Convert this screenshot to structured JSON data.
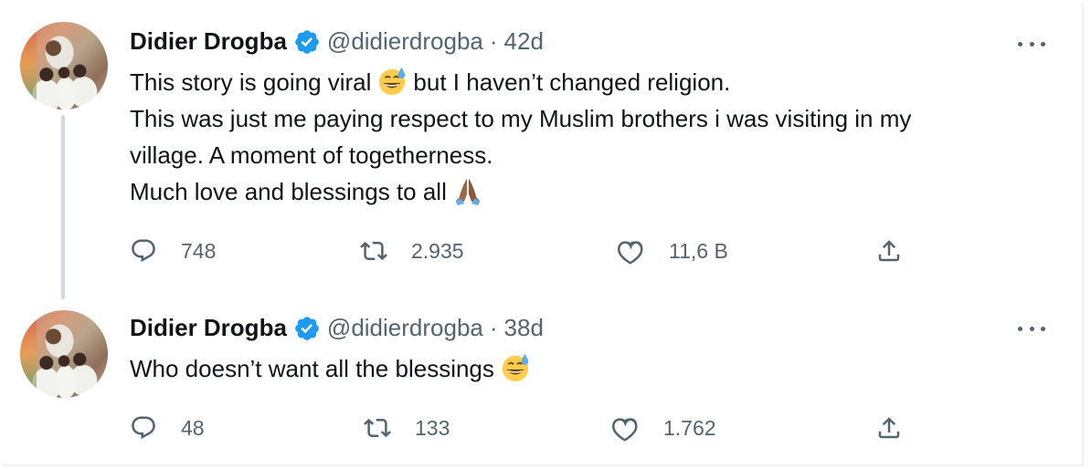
{
  "tweets": [
    {
      "author_name": "Didier Drogba",
      "handle": "@didierdrogba",
      "separator": "·",
      "time": "42d",
      "lines": [
        {
          "before": "This story is going viral",
          "emoji": "sweat-smile",
          "after": "but I haven’t changed religion."
        },
        {
          "before": "This was just me paying respect to my Muslim brothers i was visiting in my",
          "emoji": null,
          "after": ""
        },
        {
          "before": "village. A moment of togetherness.",
          "emoji": null,
          "after": ""
        },
        {
          "before": "Much love and blessings to all",
          "emoji": "folded-hands",
          "after": ""
        }
      ],
      "replies": "748",
      "retweets": "2.935",
      "likes": "11,6 B"
    },
    {
      "author_name": "Didier Drogba",
      "handle": "@didierdrogba",
      "separator": "·",
      "time": "38d",
      "lines": [
        {
          "before": "Who doesn’t want all the blessings",
          "emoji": "sweat-smile",
          "after": ""
        }
      ],
      "replies": "48",
      "retweets": "133",
      "likes": "1.762"
    }
  ],
  "colors": {
    "verified": "#1d9bf0",
    "secondary_text": "#536471",
    "thread_line": "#cfd9de"
  },
  "icons": [
    "verified-badge-icon",
    "more-options-icon",
    "reply-icon",
    "retweet-icon",
    "like-icon",
    "share-icon",
    "sweat-smile-emoji",
    "folded-hands-emoji"
  ]
}
